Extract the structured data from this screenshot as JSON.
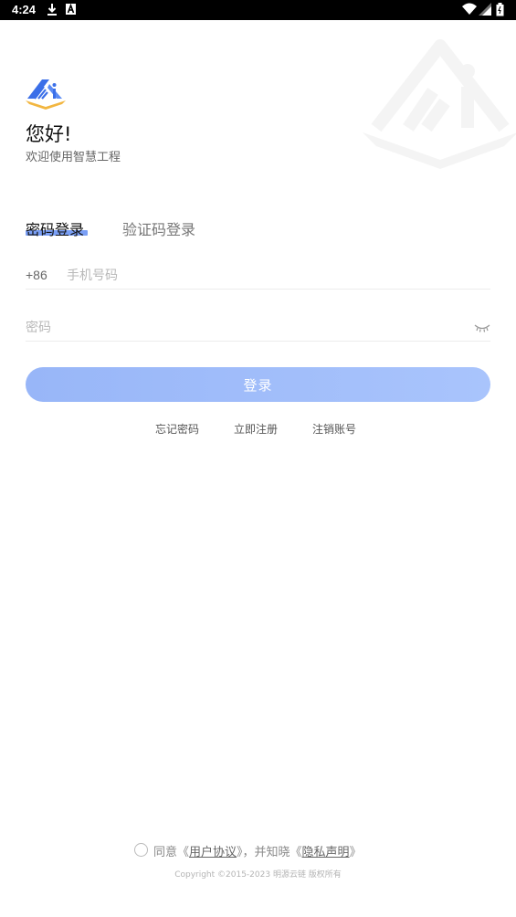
{
  "status_bar": {
    "time": "4:24",
    "icons": [
      "download-icon",
      "font-icon",
      "wifi-icon",
      "signal-icon",
      "battery-icon"
    ]
  },
  "app": {
    "greeting": "您好!",
    "subtitle": "欢迎使用智慧工程",
    "logo_icon": "app-logo-icon",
    "brand_colors": {
      "blue": "#3b6fe8",
      "gold": "#f2b640",
      "accent_underline": "#7a9ff5"
    }
  },
  "tabs": [
    {
      "label": "密码登录",
      "active": true
    },
    {
      "label": "验证码登录",
      "active": false
    }
  ],
  "form": {
    "country_code": "+86",
    "phone_placeholder": "手机号码",
    "phone_value": "",
    "password_placeholder": "密码",
    "password_value": "",
    "eye_icon": "eye-closed-icon",
    "login_label": "登录",
    "login_button_color": "#a5bffb"
  },
  "links": {
    "forgot": "忘记密码",
    "register": "立即注册",
    "cancel_account": "注销账号"
  },
  "agreement": {
    "checked": false,
    "prefix": "同意《",
    "user_agreement": "用户协议",
    "middle": "》，并知晓《",
    "privacy": "隐私声明",
    "suffix": "》"
  },
  "copyright": "Copyright ©2015-2023 明源云链 版权所有"
}
